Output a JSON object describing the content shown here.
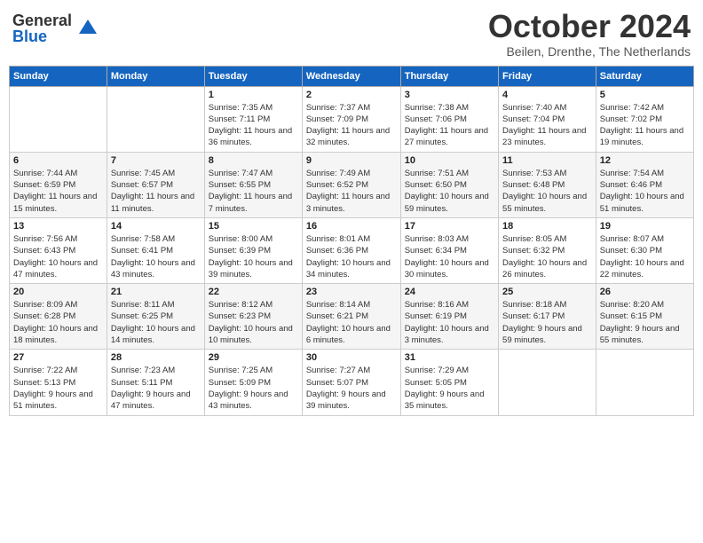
{
  "header": {
    "logo": {
      "general": "General",
      "blue": "Blue"
    },
    "title": "October 2024",
    "location": "Beilen, Drenthe, The Netherlands"
  },
  "weekdays": [
    "Sunday",
    "Monday",
    "Tuesday",
    "Wednesday",
    "Thursday",
    "Friday",
    "Saturday"
  ],
  "weeks": [
    [
      {
        "day": "",
        "sunrise": "",
        "sunset": "",
        "daylight": ""
      },
      {
        "day": "",
        "sunrise": "",
        "sunset": "",
        "daylight": ""
      },
      {
        "day": "1",
        "sunrise": "Sunrise: 7:35 AM",
        "sunset": "Sunset: 7:11 PM",
        "daylight": "Daylight: 11 hours and 36 minutes."
      },
      {
        "day": "2",
        "sunrise": "Sunrise: 7:37 AM",
        "sunset": "Sunset: 7:09 PM",
        "daylight": "Daylight: 11 hours and 32 minutes."
      },
      {
        "day": "3",
        "sunrise": "Sunrise: 7:38 AM",
        "sunset": "Sunset: 7:06 PM",
        "daylight": "Daylight: 11 hours and 27 minutes."
      },
      {
        "day": "4",
        "sunrise": "Sunrise: 7:40 AM",
        "sunset": "Sunset: 7:04 PM",
        "daylight": "Daylight: 11 hours and 23 minutes."
      },
      {
        "day": "5",
        "sunrise": "Sunrise: 7:42 AM",
        "sunset": "Sunset: 7:02 PM",
        "daylight": "Daylight: 11 hours and 19 minutes."
      }
    ],
    [
      {
        "day": "6",
        "sunrise": "Sunrise: 7:44 AM",
        "sunset": "Sunset: 6:59 PM",
        "daylight": "Daylight: 11 hours and 15 minutes."
      },
      {
        "day": "7",
        "sunrise": "Sunrise: 7:45 AM",
        "sunset": "Sunset: 6:57 PM",
        "daylight": "Daylight: 11 hours and 11 minutes."
      },
      {
        "day": "8",
        "sunrise": "Sunrise: 7:47 AM",
        "sunset": "Sunset: 6:55 PM",
        "daylight": "Daylight: 11 hours and 7 minutes."
      },
      {
        "day": "9",
        "sunrise": "Sunrise: 7:49 AM",
        "sunset": "Sunset: 6:52 PM",
        "daylight": "Daylight: 11 hours and 3 minutes."
      },
      {
        "day": "10",
        "sunrise": "Sunrise: 7:51 AM",
        "sunset": "Sunset: 6:50 PM",
        "daylight": "Daylight: 10 hours and 59 minutes."
      },
      {
        "day": "11",
        "sunrise": "Sunrise: 7:53 AM",
        "sunset": "Sunset: 6:48 PM",
        "daylight": "Daylight: 10 hours and 55 minutes."
      },
      {
        "day": "12",
        "sunrise": "Sunrise: 7:54 AM",
        "sunset": "Sunset: 6:46 PM",
        "daylight": "Daylight: 10 hours and 51 minutes."
      }
    ],
    [
      {
        "day": "13",
        "sunrise": "Sunrise: 7:56 AM",
        "sunset": "Sunset: 6:43 PM",
        "daylight": "Daylight: 10 hours and 47 minutes."
      },
      {
        "day": "14",
        "sunrise": "Sunrise: 7:58 AM",
        "sunset": "Sunset: 6:41 PM",
        "daylight": "Daylight: 10 hours and 43 minutes."
      },
      {
        "day": "15",
        "sunrise": "Sunrise: 8:00 AM",
        "sunset": "Sunset: 6:39 PM",
        "daylight": "Daylight: 10 hours and 39 minutes."
      },
      {
        "day": "16",
        "sunrise": "Sunrise: 8:01 AM",
        "sunset": "Sunset: 6:36 PM",
        "daylight": "Daylight: 10 hours and 34 minutes."
      },
      {
        "day": "17",
        "sunrise": "Sunrise: 8:03 AM",
        "sunset": "Sunset: 6:34 PM",
        "daylight": "Daylight: 10 hours and 30 minutes."
      },
      {
        "day": "18",
        "sunrise": "Sunrise: 8:05 AM",
        "sunset": "Sunset: 6:32 PM",
        "daylight": "Daylight: 10 hours and 26 minutes."
      },
      {
        "day": "19",
        "sunrise": "Sunrise: 8:07 AM",
        "sunset": "Sunset: 6:30 PM",
        "daylight": "Daylight: 10 hours and 22 minutes."
      }
    ],
    [
      {
        "day": "20",
        "sunrise": "Sunrise: 8:09 AM",
        "sunset": "Sunset: 6:28 PM",
        "daylight": "Daylight: 10 hours and 18 minutes."
      },
      {
        "day": "21",
        "sunrise": "Sunrise: 8:11 AM",
        "sunset": "Sunset: 6:25 PM",
        "daylight": "Daylight: 10 hours and 14 minutes."
      },
      {
        "day": "22",
        "sunrise": "Sunrise: 8:12 AM",
        "sunset": "Sunset: 6:23 PM",
        "daylight": "Daylight: 10 hours and 10 minutes."
      },
      {
        "day": "23",
        "sunrise": "Sunrise: 8:14 AM",
        "sunset": "Sunset: 6:21 PM",
        "daylight": "Daylight: 10 hours and 6 minutes."
      },
      {
        "day": "24",
        "sunrise": "Sunrise: 8:16 AM",
        "sunset": "Sunset: 6:19 PM",
        "daylight": "Daylight: 10 hours and 3 minutes."
      },
      {
        "day": "25",
        "sunrise": "Sunrise: 8:18 AM",
        "sunset": "Sunset: 6:17 PM",
        "daylight": "Daylight: 9 hours and 59 minutes."
      },
      {
        "day": "26",
        "sunrise": "Sunrise: 8:20 AM",
        "sunset": "Sunset: 6:15 PM",
        "daylight": "Daylight: 9 hours and 55 minutes."
      }
    ],
    [
      {
        "day": "27",
        "sunrise": "Sunrise: 7:22 AM",
        "sunset": "Sunset: 5:13 PM",
        "daylight": "Daylight: 9 hours and 51 minutes."
      },
      {
        "day": "28",
        "sunrise": "Sunrise: 7:23 AM",
        "sunset": "Sunset: 5:11 PM",
        "daylight": "Daylight: 9 hours and 47 minutes."
      },
      {
        "day": "29",
        "sunrise": "Sunrise: 7:25 AM",
        "sunset": "Sunset: 5:09 PM",
        "daylight": "Daylight: 9 hours and 43 minutes."
      },
      {
        "day": "30",
        "sunrise": "Sunrise: 7:27 AM",
        "sunset": "Sunset: 5:07 PM",
        "daylight": "Daylight: 9 hours and 39 minutes."
      },
      {
        "day": "31",
        "sunrise": "Sunrise: 7:29 AM",
        "sunset": "Sunset: 5:05 PM",
        "daylight": "Daylight: 9 hours and 35 minutes."
      },
      {
        "day": "",
        "sunrise": "",
        "sunset": "",
        "daylight": ""
      },
      {
        "day": "",
        "sunrise": "",
        "sunset": "",
        "daylight": ""
      }
    ]
  ]
}
